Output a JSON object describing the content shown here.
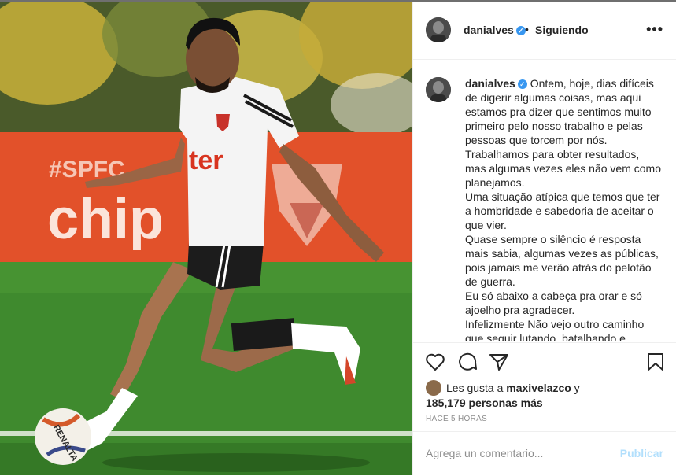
{
  "post": {
    "username": "danialves",
    "follow_status": "Siguiendo",
    "separator": "•",
    "more_label": "•••",
    "caption_lines": [
      "Ontem, hoje, dias difíceis de digerir algumas coisas, mas aqui estamos pra dizer que sentimos muito primeiro pelo nosso trabalho e pelas pessoas que torcem por nós.",
      "Trabalhamos para obter resultados, mas algumas vezes eles não vem como planejamos.",
      "Uma situação atípica que temos que ter a hombridade e sabedoria de aceitar o que vier.",
      "Quase sempre o silêncio é resposta mais sabia, algumas vezes as públicas, pois jamais me verão atrás do pelotão de guerra.",
      "Eu só abaixo a cabeça pra orar e só ajoelho pra agradecer.",
      "Infelizmente Não vejo outro caminho que seguir lutando, batalhando e"
    ],
    "likes": {
      "prefix": "Les gusta a",
      "liker": "maxivelazco",
      "conjunction": "y",
      "count": "185,179 personas más"
    },
    "timestamp": "HACE 5 HORAS",
    "comment_placeholder": "Agrega un comentario...",
    "publish_label": "Publicar"
  },
  "photo": {
    "banner_hashtag": "#SPFC",
    "banner_word": "chip",
    "shirt_sponsor": "ter",
    "ball_brand": "RENALTA"
  },
  "icons": [
    "verified-badge-icon",
    "more-options-icon",
    "heart-icon",
    "comment-icon",
    "share-icon",
    "bookmark-icon"
  ],
  "colors": {
    "verified": "#3897f0",
    "publish_disabled": "#b2dffc",
    "muted": "#8e8e8e"
  }
}
